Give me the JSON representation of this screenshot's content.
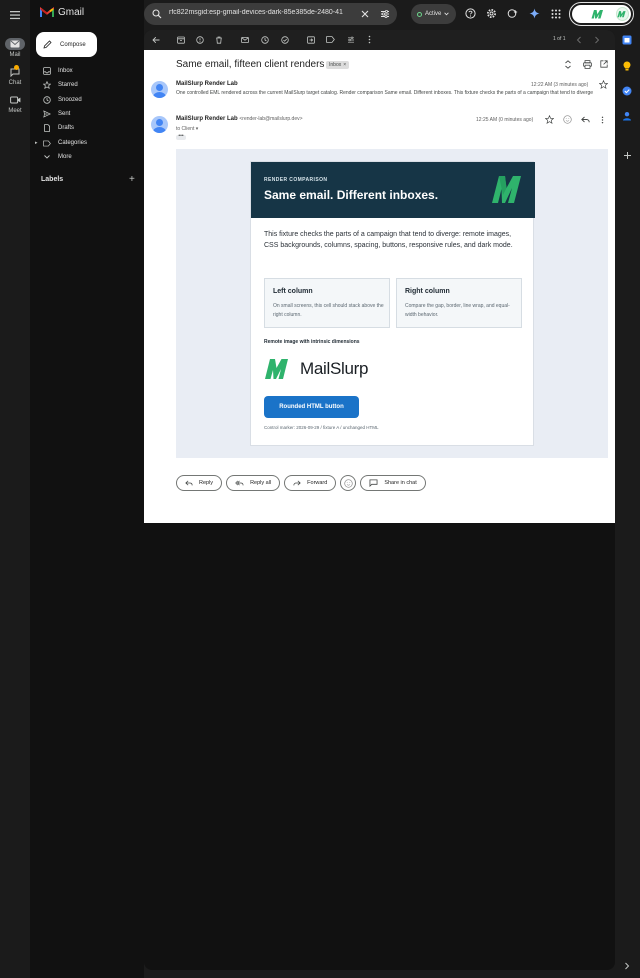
{
  "app": {
    "brand_name": "Gmail",
    "search_query": "rfc822msgid:esp-gmail-devices-dark-85e385de-2480-41",
    "status_label": "Active"
  },
  "rail": {
    "items": [
      {
        "label": "Mail",
        "icon": "mail-icon"
      },
      {
        "label": "Chat",
        "icon": "chat-icon"
      },
      {
        "label": "Meet",
        "icon": "meet-icon"
      }
    ]
  },
  "sidebar": {
    "compose_label": "Compose",
    "nav": [
      {
        "label": "Inbox",
        "icon": "inbox-icon"
      },
      {
        "label": "Starred",
        "icon": "star-icon"
      },
      {
        "label": "Snoozed",
        "icon": "clock-icon"
      },
      {
        "label": "Sent",
        "icon": "send-icon"
      },
      {
        "label": "Drafts",
        "icon": "draft-icon"
      },
      {
        "label": "Categories",
        "icon": "label-icon"
      },
      {
        "label": "More",
        "icon": "chevron-down-icon"
      }
    ],
    "labels_heading": "Labels"
  },
  "account": {
    "avatar_letter": "M"
  },
  "toolbar": {
    "pager": "1 of 1"
  },
  "thread": {
    "subject": "Same email, fifteen client renders",
    "label_chip": "Inbox",
    "collapsed_message": {
      "sender": "MailSlurp Render Lab",
      "snippet": "One controlled EML rendered across the current MailSlurp target catalog. Render comparison Same email. Different inboxes. This fixture checks the parts of a campaign that tend to diverge",
      "time": "12:22 AM (3 minutes ago)"
    },
    "open_message": {
      "sender": "MailSlurp Render Lab",
      "sender_email": "<render-lab@mailslurp.dev>",
      "to": "to Client",
      "time": "12:25 AM (0 minutes ago)"
    }
  },
  "email": {
    "kicker": "RENDER COMPARISON",
    "title": "Same email. Different inboxes.",
    "intro": "This fixture checks the parts of a campaign that tend to diverge: remote images, CSS backgrounds, columns, spacing, buttons, responsive rules, and dark mode.",
    "left_col": {
      "title": "Left column",
      "body": "On small screens, this cell should stack above the right column."
    },
    "right_col": {
      "title": "Right column",
      "body": "Compare the gap, border, line wrap, and equal-width behavior."
    },
    "image_caption": "Remote image with intrinsic dimensions",
    "logo_text": "MailSlurp",
    "cta_label": "Rounded HTML button",
    "marker": "Control marker: 2026-09-29 / fixture A / unchanged HTML",
    "colors": {
      "header_bg": "#163546",
      "cta_bg": "#1a73c8",
      "brand_green": "#2fb36c"
    }
  },
  "actions": {
    "reply": "Reply",
    "reply_all": "Reply all",
    "forward": "Forward",
    "share": "Share in chat"
  }
}
